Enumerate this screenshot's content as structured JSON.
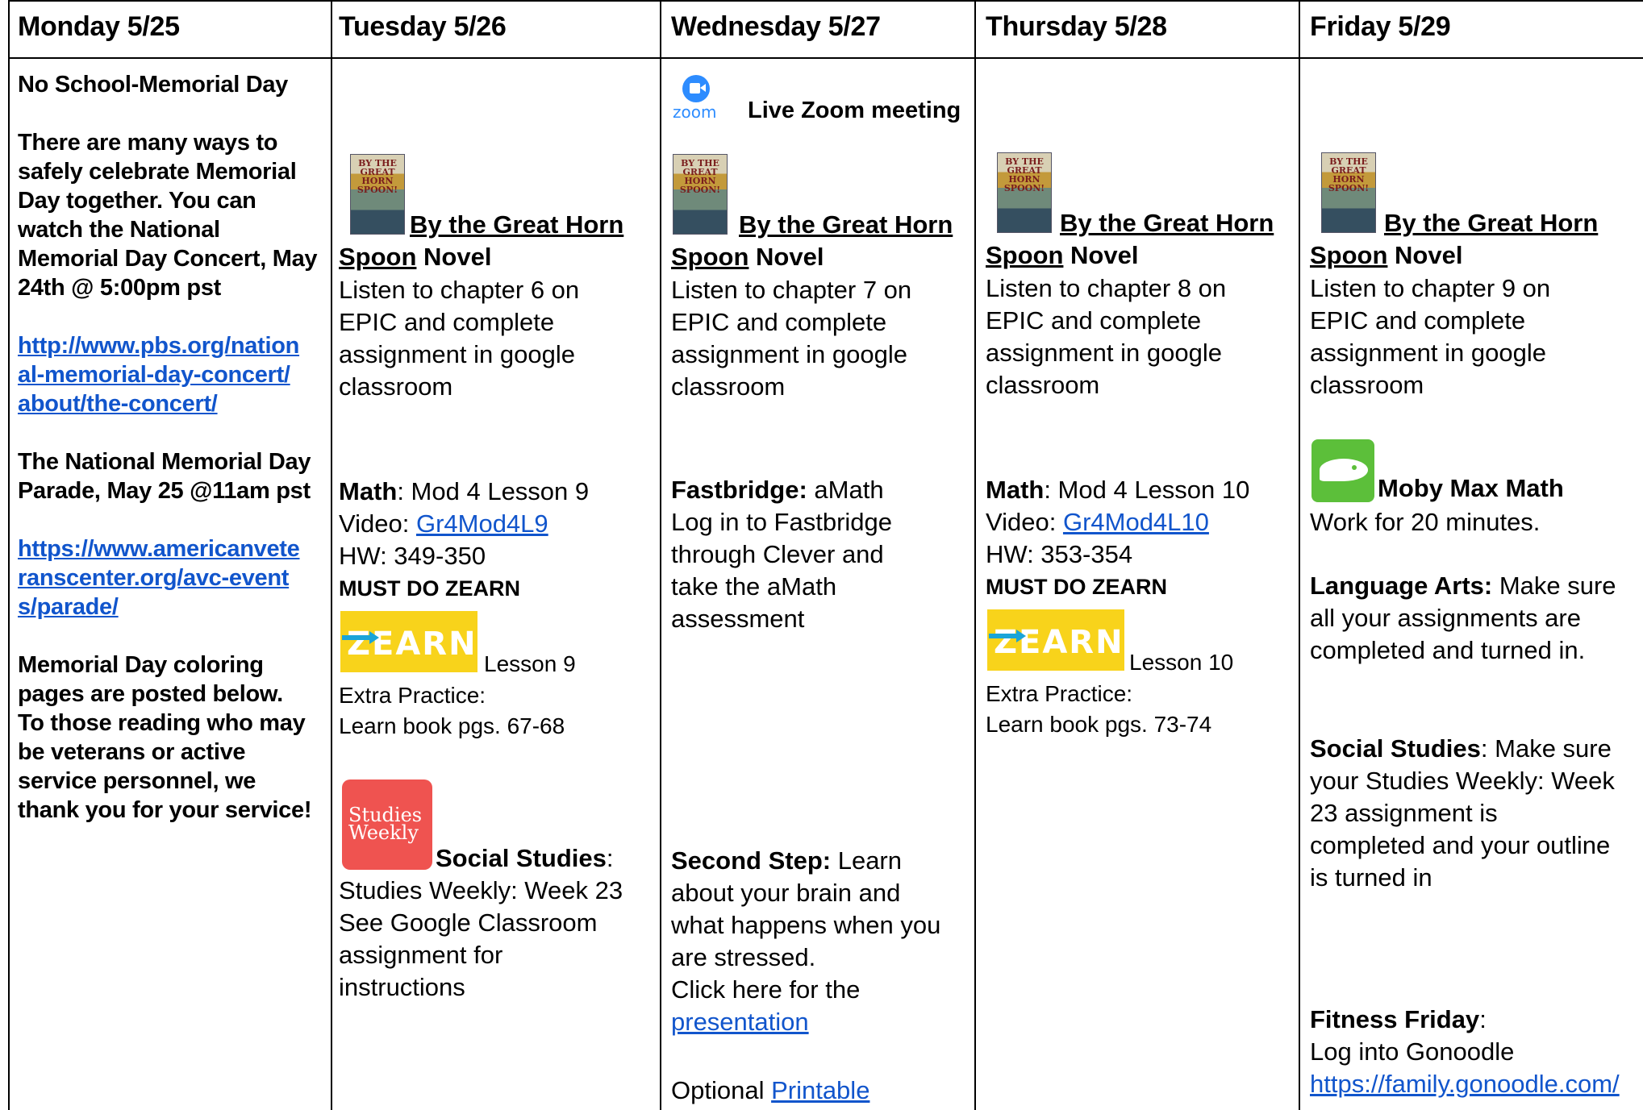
{
  "headers": [
    "Monday 5/25",
    "Tuesday 5/26",
    "Wednesday 5/27",
    "Thursday 5/28",
    "Friday 5/29"
  ],
  "monday": {
    "p1": "No School-Memorial Day",
    "p2": [
      "There are many ways to",
      "safely celebrate Memorial",
      "Day together. You can",
      "watch the National",
      "Memorial Day Concert, May",
      "24th @ 5:00pm pst"
    ],
    "link1": [
      "http://www.pbs.org/nation",
      "al-memorial-day-concert/",
      "about/the-concert/"
    ],
    "p3": [
      "The National Memorial Day",
      "Parade, May 25 @11am pst"
    ],
    "link2": [
      "https://www.americanvete",
      "ranscenter.org/avc-event",
      "s/parade/"
    ],
    "p4": [
      "Memorial Day coloring",
      "pages are posted below."
    ],
    "p5": [
      "To those reading who may",
      "be veterans or active",
      "service personnel, we",
      "thank you for your service!"
    ]
  },
  "book": {
    "cover_text": "BY THE GREAT HORN SPOON!",
    "title_a": "By the Great Horn",
    "title_b": "Spoon",
    "novel": " Novel"
  },
  "tuesday": {
    "reading": [
      "Listen to chapter 6 on",
      "EPIC and complete",
      "assignment in google",
      "classroom"
    ],
    "math_label": "Math",
    "math_text": ": Mod 4 Lesson 9",
    "video_label": "Video: ",
    "video_link": "Gr4Mod4L9",
    "hw": "HW: 349-350",
    "zearn_must": "MUST DO ZEARN",
    "zearn_lesson": "Lesson 9",
    "extra": [
      "Extra Practice:",
      "Learn book pgs. 67-68"
    ],
    "ss_label": "Social Studies",
    "ss_colon": ":",
    "ss_text": [
      "Studies Weekly: Week 23",
      "See Google Classroom",
      "assignment for",
      "instructions"
    ]
  },
  "wednesday": {
    "zoom_word": "zoom",
    "zoom_text": "Live Zoom meeting",
    "reading": [
      "Listen to chapter 7 on",
      "EPIC and complete",
      "assignment in google",
      "classroom"
    ],
    "fast_label": "Fastbridge:",
    "fast_text": " aMath",
    "fast_lines": [
      "Log in to Fastbridge",
      "through Clever and",
      "take the aMath",
      "assessment"
    ],
    "ss_label": "Second Step:",
    "ss_first": " Learn",
    "ss_lines": [
      "about your brain and",
      "what happens when you",
      "are stressed.",
      "Click here for the"
    ],
    "ss_link": "presentation",
    "opt_label": "Optional ",
    "opt_link": "Printable"
  },
  "thursday": {
    "reading": [
      "Listen to chapter 8 on",
      "EPIC and complete",
      "assignment in google",
      "classroom"
    ],
    "math_label": "Math",
    "math_text": ": Mod 4 Lesson 10",
    "video_label": "Video: ",
    "video_link": "Gr4Mod4L10",
    "hw": "HW: 353-354",
    "zearn_must": "MUST DO ZEARN",
    "zearn_lesson": "Lesson 10",
    "extra": [
      "Extra Practice:",
      "Learn book pgs. 73-74"
    ]
  },
  "friday": {
    "reading": [
      "Listen to chapter 9 on",
      "EPIC and complete",
      "assignment in google",
      "classroom"
    ],
    "moby_label": "Moby Max Math",
    "moby_text": "Work for 20 minutes.",
    "la_label": "Language Arts:",
    "la_first": " Make sure",
    "la_lines": [
      "all your assignments are",
      "completed and turned in."
    ],
    "ss_label": "Social Studies",
    "ss_first": ": Make sure",
    "ss_lines": [
      "your Studies Weekly: Week",
      "23  assignment is",
      "completed and your outline",
      "is turned in"
    ],
    "fit_label": "Fitness Friday",
    "fit_colon": ":",
    "fit_line": "Log into Gonoodle",
    "fit_link": "https://family.gonoodle.com/"
  },
  "zearn_logo": "ZEARN",
  "sw_logo": [
    "Studies",
    "Weekly"
  ]
}
